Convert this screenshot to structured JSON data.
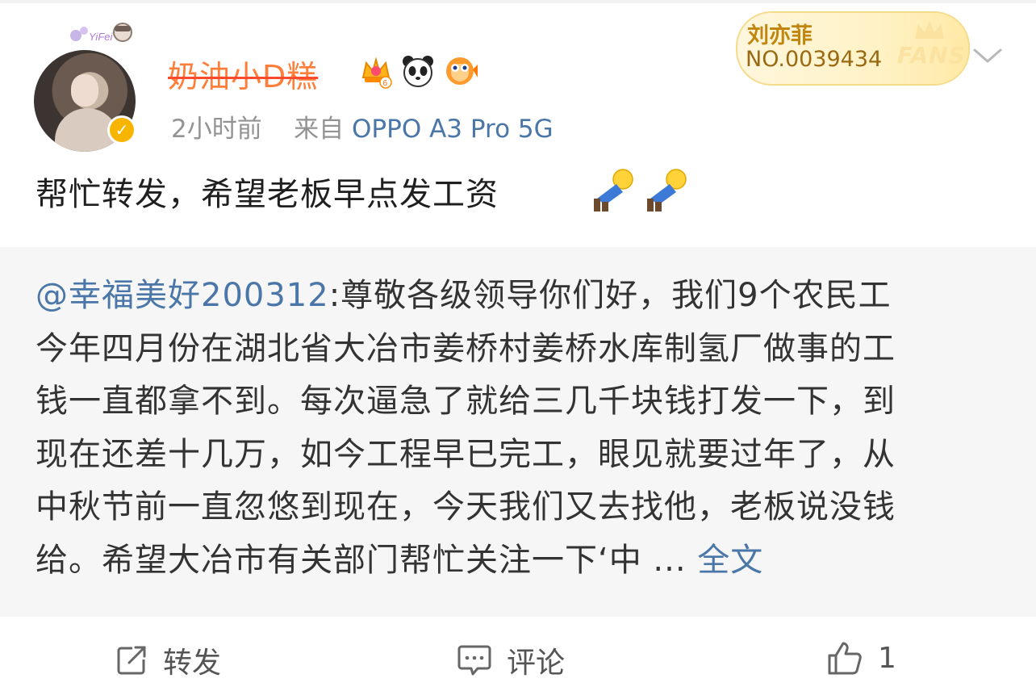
{
  "post": {
    "username": "奶油小D糕",
    "time": "2小时前",
    "source_prefix": "来自",
    "device": "OPPO A3 Pro 5G",
    "text": "帮忙转发，希望老板早点发工资",
    "fans_card": {
      "name": "刘亦菲",
      "number": "NO.0039434",
      "label": "FANS"
    },
    "badges": [
      "crown-level-6-icon",
      "panda-icon",
      "fish-icon"
    ],
    "emoji": [
      "doge-man-kneel-icon",
      "doge-man-kneel-icon"
    ]
  },
  "repost": {
    "mention": "@幸福美好200312",
    "lines": [
      ":尊敬各级领导你们好，我们9个农民工",
      "今年四月份在湖北省大冶市姜桥村姜桥水库制氢厂做事的工",
      "钱一直都拿不到。每次逼急了就给三几千块钱打发一下，到",
      "现在还差十几万，如今工程早已完工，眼见就要过年了，从",
      "中秋节前一直忽悠到现在，今天我们又去找他，老板说没钱",
      "给。希望大冶市有关部门帮忙关注一下‘中 ... "
    ],
    "full_text_link": "全文"
  },
  "actions": {
    "repost_label": "转发",
    "comment_label": "评论",
    "like_count": "1"
  },
  "colors": {
    "link": "#4a76a8",
    "username": "#ff7f3a",
    "repost_bg": "#f6f6f6"
  }
}
